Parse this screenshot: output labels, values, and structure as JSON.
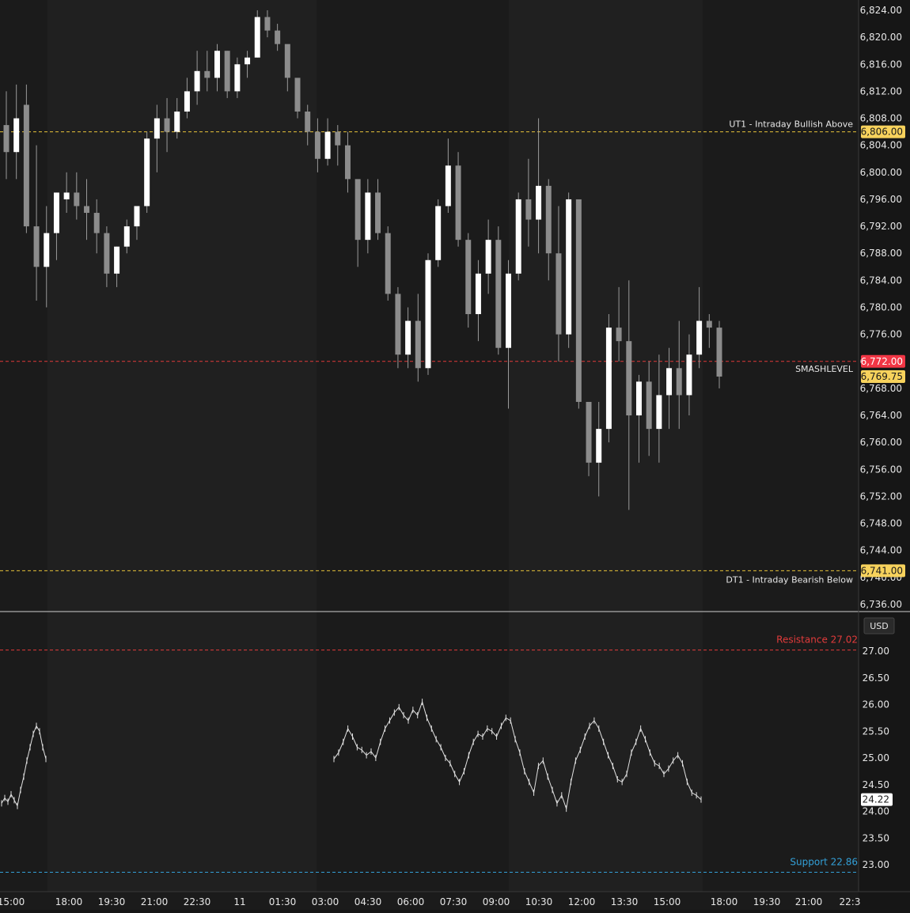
{
  "colors": {
    "background": "#1b1b1b",
    "session_band": "#202020",
    "separator": "#cfcfcf",
    "up_candle": "#ffffff",
    "down_candle": "#8c8c8c",
    "wick": "#9a9a9a",
    "level_yellow": "#e8c33a",
    "level_red": "#e23b3b",
    "level_blue": "#33a0d8",
    "axis_text": "#e6e6e6",
    "price_badge": "#f7d25c",
    "smash_badge": "#f23645",
    "current_badge": "#f7d25c",
    "indicator_line": "#e0e0e0"
  },
  "chart_data": [
    {
      "type": "candlestick",
      "title": "",
      "ylabel": "",
      "ylim": [
        6734.5,
        6825.5
      ],
      "y_ticks": [
        "6,824.00",
        "6,820.00",
        "6,816.00",
        "6,812.00",
        "6,808.00",
        "6,804.00",
        "6,800.00",
        "6,796.00",
        "6,792.00",
        "6,788.00",
        "6,784.00",
        "6,780.00",
        "6,776.00",
        "6,772.00",
        "6,768.00",
        "6,764.00",
        "6,760.00",
        "6,756.00",
        "6,752.00",
        "6,748.00",
        "6,744.00",
        "6,740.00",
        "6,736.00"
      ],
      "levels": [
        {
          "label": "UT1 - Intraday Bullish Above",
          "value": 6806.0,
          "badge": "6,806.00",
          "style": "yellow-dash"
        },
        {
          "label": "SMASHLEVEL",
          "value": 6772.0,
          "badge": "6,772.00",
          "style": "red-dash"
        },
        {
          "label": "DT1 - Intraday Bearish Below",
          "value": 6741.0,
          "badge": "6,741.00",
          "style": "yellow-dash"
        }
      ],
      "last_price": {
        "value": 6769.75,
        "badge": "6,769.75"
      },
      "series": [
        {
          "points": [
            [
              6807,
              6812,
              6799,
              6803
            ],
            [
              6803,
              6813,
              6799,
              6808
            ],
            [
              6810,
              6813,
              6791,
              6792
            ],
            [
              6792,
              6804,
              6781,
              6786
            ],
            [
              6786,
              6795,
              6780,
              6791
            ],
            [
              6791,
              6797,
              6787,
              6797
            ],
            [
              6796,
              6800,
              6794,
              6797
            ],
            [
              6797,
              6800,
              6793,
              6795
            ],
            [
              6795,
              6799,
              6790,
              6794
            ],
            [
              6794,
              6796,
              6788,
              6791
            ],
            [
              6791,
              6792,
              6783,
              6785
            ],
            [
              6785,
              6789,
              6783,
              6789
            ],
            [
              6789,
              6793,
              6788,
              6792
            ],
            [
              6792,
              6795,
              6790,
              6795
            ],
            [
              6795,
              6806,
              6794,
              6805
            ],
            [
              6805,
              6810,
              6800,
              6808
            ],
            [
              6808,
              6811,
              6803,
              6806
            ],
            [
              6806,
              6811,
              6805,
              6809
            ],
            [
              6809,
              6814,
              6808,
              6812
            ],
            [
              6812,
              6818,
              6810,
              6815
            ],
            [
              6815,
              6818,
              6812,
              6814
            ],
            [
              6814,
              6819,
              6812,
              6818
            ],
            [
              6818,
              6818,
              6811,
              6812
            ],
            [
              6812,
              6817,
              6811,
              6816
            ],
            [
              6816,
              6818,
              6814,
              6817
            ],
            [
              6817,
              6824,
              6817,
              6823
            ],
            [
              6823,
              6824,
              6820,
              6821
            ],
            [
              6821,
              6822,
              6818,
              6819
            ],
            [
              6819,
              6817,
              6812,
              6814
            ],
            [
              6814,
              6813,
              6808,
              6809
            ],
            [
              6809,
              6810,
              6804,
              6806
            ],
            [
              6806,
              6808,
              6800,
              6802
            ],
            [
              6802,
              6808,
              6801,
              6806
            ],
            [
              6806,
              6807,
              6801,
              6804
            ],
            [
              6804,
              6806,
              6797,
              6799
            ],
            [
              6799,
              6797,
              6786,
              6790
            ],
            [
              6790,
              6799,
              6788,
              6797
            ],
            [
              6797,
              6799,
              6790,
              6791
            ],
            [
              6791,
              6792,
              6781,
              6782
            ],
            [
              6782,
              6783,
              6771,
              6773
            ],
            [
              6773,
              6780,
              6771,
              6778
            ],
            [
              6778,
              6782,
              6769,
              6771
            ],
            [
              6771,
              6788,
              6770,
              6787
            ],
            [
              6787,
              6796,
              6786,
              6795
            ],
            [
              6795,
              6805,
              6794,
              6801
            ],
            [
              6801,
              6803,
              6789,
              6790
            ],
            [
              6790,
              6791,
              6777,
              6779
            ],
            [
              6779,
              6787,
              6775,
              6785
            ],
            [
              6785,
              6793,
              6782,
              6790
            ],
            [
              6790,
              6792,
              6773,
              6774
            ],
            [
              6774,
              6787,
              6765,
              6785
            ],
            [
              6785,
              6797,
              6784,
              6796
            ],
            [
              6796,
              6802,
              6789,
              6793
            ],
            [
              6793,
              6808,
              6788,
              6798
            ],
            [
              6798,
              6799,
              6784,
              6788
            ],
            [
              6788,
              6795,
              6772,
              6776
            ],
            [
              6776,
              6797,
              6774,
              6796
            ],
            [
              6796,
              6795,
              6765,
              6766
            ],
            [
              6766,
              6763,
              6755,
              6757
            ],
            [
              6757,
              6766,
              6752,
              6762
            ],
            [
              6762,
              6779,
              6760,
              6777
            ],
            [
              6777,
              6783,
              6772,
              6775
            ],
            [
              6775,
              6784,
              6750,
              6764
            ],
            [
              6764,
              6770,
              6757,
              6769
            ],
            [
              6769,
              6772,
              6758,
              6762
            ],
            [
              6762,
              6773,
              6757,
              6767
            ],
            [
              6767,
              6774,
              6762,
              6771
            ],
            [
              6771,
              6778,
              6762,
              6767
            ],
            [
              6767,
              6776,
              6764,
              6773
            ],
            [
              6773,
              6783,
              6771,
              6778
            ],
            [
              6778,
              6779,
              6774,
              6777
            ],
            [
              6777,
              6778,
              6768,
              6769.75
            ]
          ]
        }
      ]
    },
    {
      "type": "line",
      "title": "",
      "ylabel": "",
      "ylim": [
        22.75,
        27.65
      ],
      "y_ticks": [
        "27.00",
        "26.50",
        "26.00",
        "25.50",
        "25.00",
        "24.50",
        "24.00",
        "23.50",
        "23.00"
      ],
      "currency_label": "USD",
      "levels": [
        {
          "label": "Resistance 27.02",
          "value": 27.02,
          "style": "red-dash"
        },
        {
          "label": "Support 22.86",
          "value": 22.86,
          "style": "blue-dash"
        }
      ],
      "last_value": {
        "value": 24.22,
        "badge": "24.22"
      },
      "series": [
        {
          "segments": [
            [
              24.15,
              24.25,
              24.18,
              24.32,
              24.21,
              24.1,
              24.4,
              24.65,
              24.95,
              25.2,
              25.45,
              25.6,
              25.5,
              25.2,
              24.98
            ],
            [
              24.98,
              25.1,
              25.3,
              25.55,
              25.4,
              25.2,
              25.15,
              25.05,
              25.12,
              25.0,
              25.3,
              25.55,
              25.7,
              25.85,
              25.95,
              25.8,
              25.7,
              25.9,
              25.8,
              26.05,
              25.75,
              25.55,
              25.35,
              25.2,
              25.0,
              24.9,
              24.7,
              24.55,
              24.75,
              25.05,
              25.3,
              25.45,
              25.4,
              25.55,
              25.5,
              25.4,
              25.6,
              25.75,
              25.7,
              25.35,
              25.1,
              24.75,
              24.55,
              24.35,
              24.85,
              24.95,
              24.65,
              24.4,
              24.15,
              24.3,
              24.05,
              24.55,
              24.95,
              25.15,
              25.4,
              25.6,
              25.7,
              25.55,
              25.3,
              25.05,
              24.85,
              24.6,
              24.55,
              24.7,
              25.1,
              25.3,
              25.55,
              25.35,
              25.1,
              24.9,
              24.85,
              24.7,
              24.8,
              24.95,
              25.05,
              24.9,
              24.55,
              24.35,
              24.3,
              24.22
            ]
          ]
        }
      ]
    }
  ],
  "x_axis": {
    "labels": [
      "15:00",
      "18:00",
      "19:30",
      "21:00",
      "22:30",
      "11",
      "01:30",
      "03:00",
      "04:30",
      "06:00",
      "07:30",
      "09:00",
      "10:30",
      "12:00",
      "13:30",
      "15:00",
      "18:00",
      "19:30",
      "21:00",
      "22:3"
    ]
  }
}
